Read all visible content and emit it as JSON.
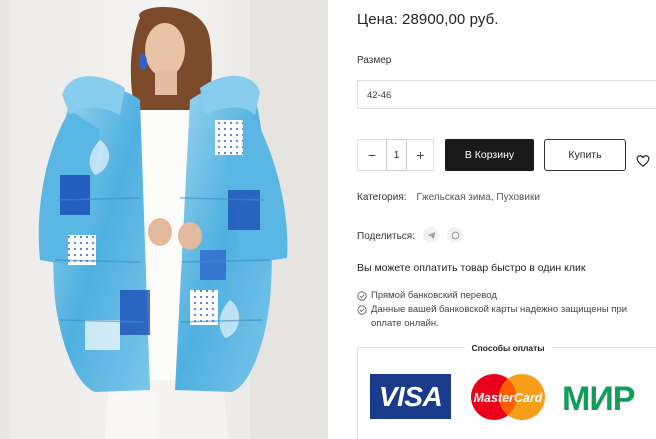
{
  "product": {
    "price_text": "Цена: 28900,00 руб.",
    "size_label": "Размер",
    "size_selected": "42-46",
    "quantity": "1",
    "qty_minus": "−",
    "qty_plus": "+",
    "add_to_cart_label": "В Корзину",
    "buy_label": "Купить",
    "category_label": "Категория:",
    "category_value": "Гжельская зима, Пуховики",
    "share_label": "Поделиться:"
  },
  "payment": {
    "quick_pay_text": "Вы можете оплатить товар быстро в один клик",
    "features": [
      "Прямой банковский перевод",
      "Данные вашей банковской карты надежно защищены при оплате онлайн."
    ],
    "methods_title": "Способы оплаты",
    "logos": {
      "visa": "VISA",
      "mastercard": "MasterCard",
      "mir": "МИР"
    }
  },
  "icons": {
    "heart": "heart-icon",
    "telegram": "telegram-icon",
    "whatsapp": "whatsapp-icon",
    "check": "check-circle-icon"
  },
  "colors": {
    "cart_button": "#1a1a1a",
    "visa_blue": "#1a3a8c",
    "mc_red": "#eb001b",
    "mc_orange": "#f79e1b",
    "mir_green": "#0f9d58",
    "mir_blue": "#1e6fb3"
  }
}
